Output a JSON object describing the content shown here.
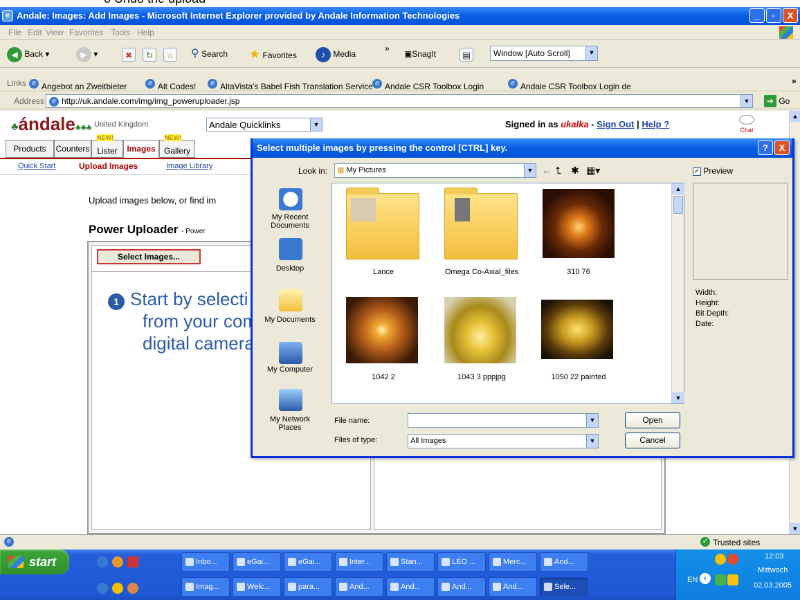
{
  "top_fragment": "o   Undo the upload",
  "window": {
    "title": "Andale: Images: Add Images - Microsoft Internet Explorer provided by Andale Information Technologies",
    "min": "_",
    "max": "▫",
    "close": "X"
  },
  "menu": [
    "File",
    "Edit",
    "View",
    "Favorites",
    "Tools",
    "Help"
  ],
  "toolbar": {
    "back": "Back",
    "search": "Search",
    "favorites": "Favorites",
    "media": "Media",
    "chevron": "»",
    "snagit": "SnagIt",
    "window_select": "Window [Auto Scroll]"
  },
  "links": {
    "label": "Links",
    "items": [
      "Angebot an Zweitbieter",
      "Alt Codes!",
      "AltaVista's Babel Fish Translation Service",
      "Andale CSR Toolbox Login",
      "Andale CSR Toolbox Login de"
    ],
    "chevron": "»"
  },
  "address": {
    "label": "Address",
    "url": "http://uk.andale.com/img/img_poweruploader.jsp",
    "go": "Go"
  },
  "page": {
    "logo": "ándale",
    "region": "United Kingdom",
    "quicklinks": "Andale Quicklinks",
    "signed_in_prefix": "Signed in as",
    "username": "ukalka",
    "dash": "-",
    "sign_out": "Sign Out",
    "sep": "|",
    "help": "Help ?",
    "chat": "Chat",
    "tabs": [
      "Products",
      "Counters",
      "Lister",
      "Images",
      "Gallery"
    ],
    "new_badge": "NEW!",
    "subnav": [
      "Quick Start",
      "Upload Images",
      "Image Library"
    ],
    "upload_text": "Upload images below, or find im",
    "pu_title": "Power Uploader",
    "pu_sub": "- Power",
    "select_btn": "Select Images...",
    "step_num": "1",
    "step_lines": [
      "Start by selecti",
      "from your com",
      "digital camera."
    ]
  },
  "dialog": {
    "title": "Select multiple images by pressing the control [CTRL] key.",
    "help": "?",
    "close": "X",
    "look_in_label": "Look in:",
    "look_in_value": "My Pictures",
    "preview_label": "Preview",
    "places": [
      "My Recent Documents",
      "Desktop",
      "My Documents",
      "My Computer",
      "My Network Places"
    ],
    "items": [
      "Lance",
      "Omega Co-Axial_files",
      "310 76",
      "1042 2",
      "1043 3 pppjpg",
      "1050 22 painted"
    ],
    "file_name_label": "File name:",
    "file_name_value": "",
    "files_type_label": "Files of type:",
    "files_type_value": "All Images",
    "open": "Open",
    "cancel": "Cancel",
    "meta": [
      "Width:",
      "Height:",
      "Bit Depth:",
      "Date:"
    ]
  },
  "status": {
    "zone": "Trusted sites"
  },
  "taskbar": {
    "start": "start",
    "row1": [
      "Inbo...",
      "eGai...",
      "eGai...",
      "Inter...",
      "Stan...",
      "LEO ...",
      "Merc...",
      "And..."
    ],
    "row2": [
      "Imag...",
      "Welc...",
      "para...",
      "And...",
      "And...",
      "And...",
      "And...",
      "Sele..."
    ],
    "lang": "EN",
    "time": "12:03",
    "day": "Mittwoch",
    "date": "02.03.2005"
  }
}
